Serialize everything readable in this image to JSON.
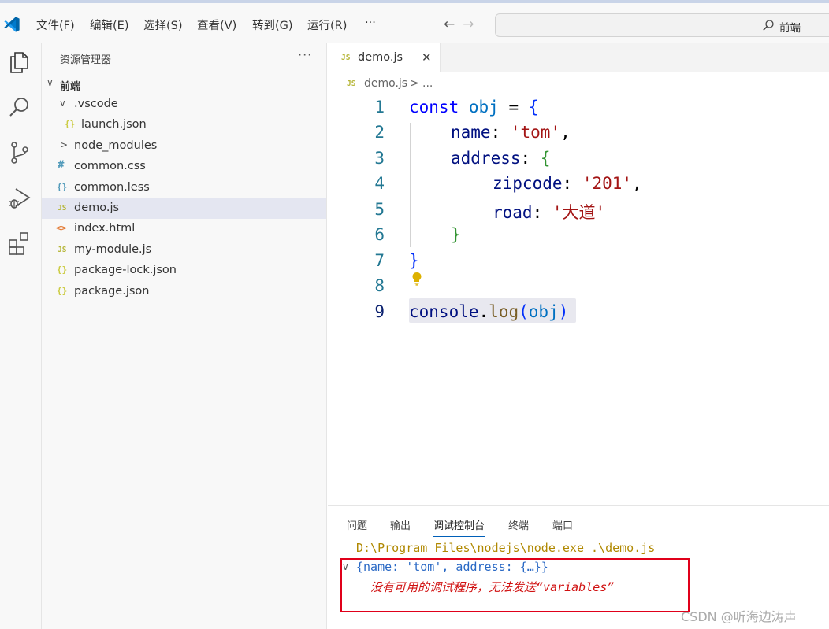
{
  "menu": {
    "items": [
      "文件(F)",
      "编辑(E)",
      "选择(S)",
      "查看(V)",
      "转到(G)",
      "运行(R)",
      "···"
    ],
    "back_arrow": "←",
    "forward_arrow": "→",
    "command_center_text": "前端"
  },
  "sidebar": {
    "title": "资源管理器",
    "more": "···",
    "tree": [
      {
        "label": "前端",
        "chevron": "∨",
        "bold": true
      },
      {
        "label": ".vscode",
        "chevron": "∨"
      },
      {
        "label": "launch.json",
        "icon": "{}"
      },
      {
        "label": "node_modules",
        "chevron": ">"
      },
      {
        "label": "common.css",
        "icon": "#"
      },
      {
        "label": "common.less",
        "icon": "{}"
      },
      {
        "label": "demo.js",
        "icon": "JS",
        "selected": true
      },
      {
        "label": "index.html",
        "icon": "<>"
      },
      {
        "label": "my-module.js",
        "icon": "JS"
      },
      {
        "label": "package-lock.json",
        "icon": "{}"
      },
      {
        "label": "package.json",
        "icon": "{}"
      }
    ]
  },
  "editor": {
    "tab": {
      "icon": "JS",
      "label": "demo.js",
      "close": "✕"
    },
    "breadcrumb": {
      "icon": "JS",
      "file": "demo.js",
      "separator": ">",
      "rest": "..."
    },
    "line_numbers": [
      "1",
      "2",
      "3",
      "4",
      "5",
      "6",
      "7",
      "8",
      "9"
    ],
    "code": {
      "l1": {
        "kw": "const",
        "var": "obj",
        "op": " = ",
        "brace": "{"
      },
      "l2": {
        "prop": "name",
        "colon": ": ",
        "str": "'tom'",
        "comma": ","
      },
      "l3": {
        "prop": "address",
        "colon": ": ",
        "brace": "{"
      },
      "l4": {
        "prop": "zipcode",
        "colon": ": ",
        "str": "'201'",
        "comma": ","
      },
      "l5": {
        "prop": "road",
        "colon": ": ",
        "str": "'大道'"
      },
      "l6": {
        "brace": "}"
      },
      "l7": {
        "brace": "}"
      },
      "l9": {
        "obj": "console",
        "dot": ".",
        "fn": "log",
        "open": "(",
        "arg": "obj",
        "close": ")"
      }
    }
  },
  "panel": {
    "tabs": [
      "问题",
      "输出",
      "调试控制台",
      "终端",
      "端口"
    ],
    "active_tab": "调试控制台",
    "cmd_line": "D:\\Program Files\\nodejs\\node.exe .\\demo.js",
    "obj_chevron": "∨",
    "obj_line": "{name: 'tom', address: {…}}",
    "error_line": "没有可用的调试程序，无法发送“variables”"
  },
  "watermark": "CSDN @听海边涛声",
  "colors": {
    "accent": "#005fb8",
    "selection": "#e4e6f1",
    "annotation_box": "#e0001a"
  }
}
